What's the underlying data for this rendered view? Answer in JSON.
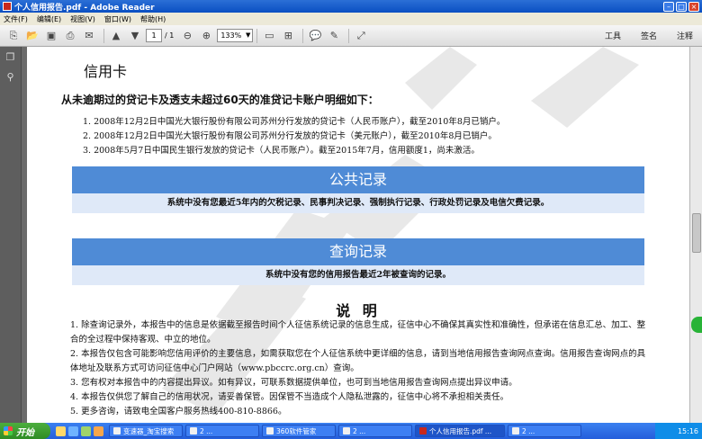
{
  "window": {
    "title": "个人信用报告.pdf - Adobe Reader"
  },
  "menu": [
    "文件(F)",
    "编辑(E)",
    "视图(V)",
    "窗口(W)",
    "帮助(H)"
  ],
  "toolbar": {
    "page_current": "1",
    "page_total": "/ 1",
    "zoom": "133%",
    "tools_label": "工具",
    "sign_label": "签名",
    "comment_label": "注释"
  },
  "document": {
    "section_heading": "信用卡",
    "subheading": "从未逾期过的贷记卡及透支未超过60天的准贷记卡账户明细如下：",
    "cards": [
      "1. 2008年12月2日中国光大银行股份有限公司苏州分行发放的贷记卡（人民币账户），截至2010年8月已销户。",
      "2. 2008年12月2日中国光大银行股份有限公司苏州分行发放的贷记卡（美元账户），截至2010年8月已销户。",
      "3. 2008年5月7日中国民生银行发放的贷记卡（人民币账户）。截至2015年7月，信用额度1，尚未激活。"
    ],
    "public_records": {
      "title": "公共记录",
      "text": "系统中没有您最近5年内的欠税记录、民事判决记录、强制执行记录、行政处罚记录及电信欠费记录。"
    },
    "query_records": {
      "title": "查询记录",
      "text": "系统中没有您的信用报告最近2年被查询的记录。"
    },
    "notes_title": "说 明",
    "notes": [
      "1. 除查询记录外，本报告中的信息是依据截至报告时间个人征信系统记录的信息生成，征信中心不确保其真实性和准确性，但承诺在信息汇总、加工、整合的全过程中保持客观、中立的地位。",
      "2. 本报告仅包含可能影响您信用评价的主要信息，如需获取您在个人征信系统中更详细的信息，请到当地信用报告查询网点查询。信用报告查询网点的具体地址及联系方式可访问征信中心门户网站（www.pbccrc.org.cn）查询。",
      "3. 您有权对本报告中的内容提出异议。如有异议，可联系数据提供单位，也可到当地信用报告查询网点提出异议申请。",
      "4. 本报告仅供您了解自己的信用状况，请妥善保管。因保管不当造成个人隐私泄露的，征信中心将不承担相关责任。",
      "5. 更多咨询，请致电全国客户服务热线400-810-8866。"
    ]
  },
  "taskbar": {
    "start_label": "开始",
    "tasks": [
      "变速器_淘宝搜索",
      "2 ...",
      "360软件管家",
      "2 ...",
      "个人信用报告.pdf ...",
      "2 ..."
    ],
    "clock": "15:16"
  },
  "colors": {
    "band_head": "#4f8bd6",
    "band_body": "#dfe9f8",
    "titlebar": "#0a4fc2",
    "taskbar": "#245edb"
  }
}
